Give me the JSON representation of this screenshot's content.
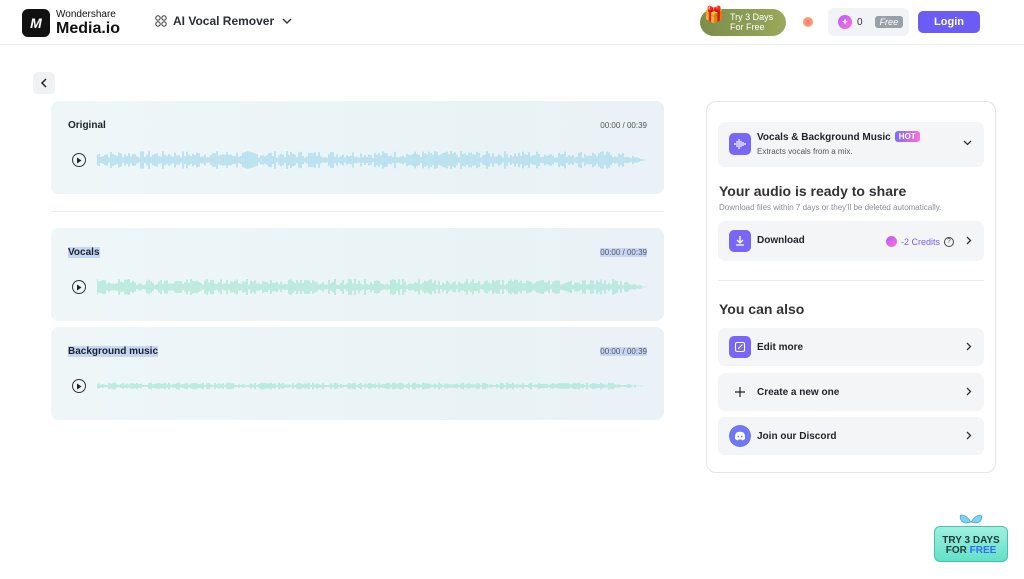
{
  "header": {
    "brand_line1": "Wondershare",
    "brand_line2": "Media.io",
    "logo_mark": "M",
    "tool_name": "AI Vocal Remover",
    "trial_line1": "Try 3 Days",
    "trial_line2": "For Free",
    "credits_count": "0",
    "plan_badge": "Free",
    "login_label": "Login"
  },
  "tracks": [
    {
      "name": "Original",
      "time": "00:00 / 00:39"
    },
    {
      "name": "Vocals",
      "time": "00:00 / 00:39"
    },
    {
      "name": "Background music",
      "time": "00:00 / 00:39"
    }
  ],
  "panel": {
    "mode": {
      "title": "Vocals & Background Music",
      "badge": "HOT",
      "subtitle": "Extracts vocals from a mix."
    },
    "ready_title": "Your audio is ready to share",
    "ready_note": "Download files within 7 days or they'll be deleted automatically.",
    "download": {
      "label": "Download",
      "cost": "-2 Credits"
    },
    "also_title": "You can also",
    "actions": [
      {
        "label": "Edit more"
      },
      {
        "label": "Create a new one"
      },
      {
        "label": "Join our Discord"
      }
    ]
  },
  "promo": {
    "line1": "TRY 3 DAYS",
    "line2_a": "FOR ",
    "line2_b": "FREE"
  },
  "colors": {
    "accent": "#6b5cf6",
    "wave_original": "#8fd0e8",
    "wave_stems": "#8fe0c8"
  },
  "icons": [
    "logo-icon",
    "grid-icon",
    "chevron-down-icon",
    "gift-icon",
    "gem-icon",
    "back-arrow-icon",
    "play-icon",
    "waveform-icon",
    "download-icon",
    "help-icon",
    "chevron-right-icon",
    "edit-icon",
    "plus-icon",
    "discord-icon"
  ]
}
